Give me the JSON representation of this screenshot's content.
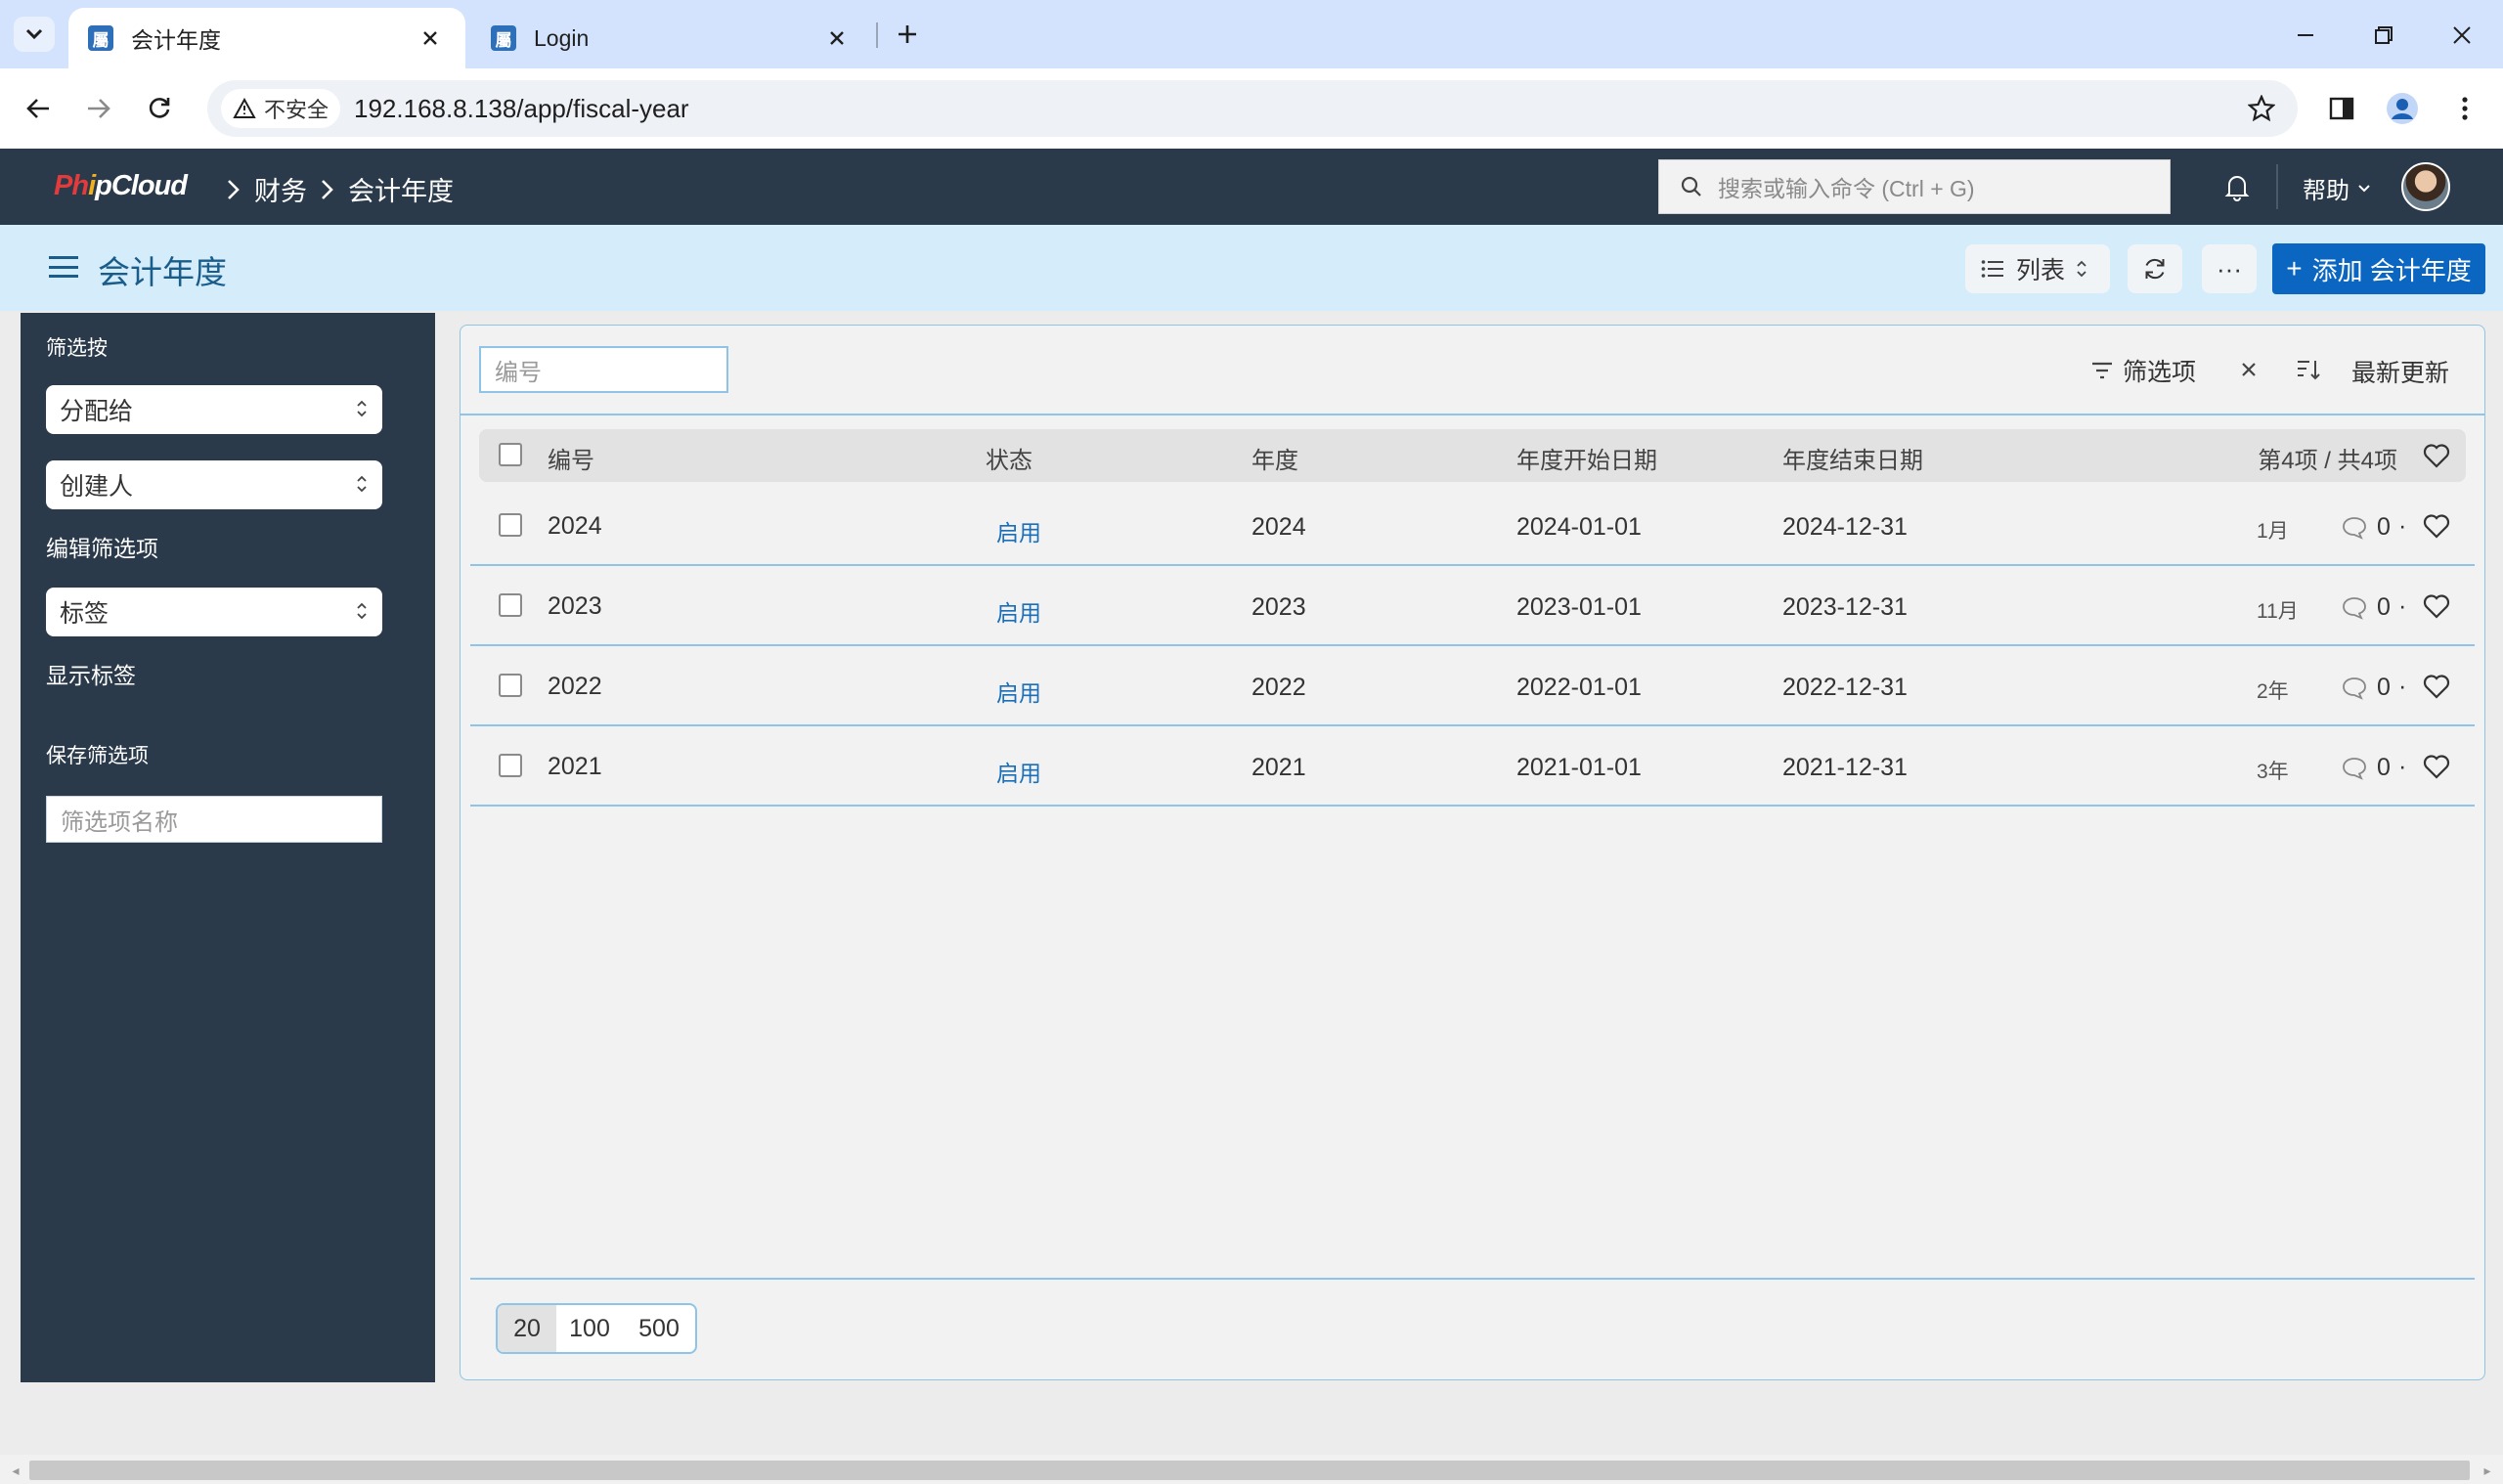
{
  "browser": {
    "tabs": [
      {
        "title": "会计年度",
        "favicon": "屬",
        "active": true
      },
      {
        "title": "Login",
        "favicon": "屬",
        "active": false
      }
    ],
    "security_label": "不安全",
    "url": "192.168.8.138/app/fiscal-year"
  },
  "navbar": {
    "logo_part1": "Ph",
    "logo_part2": "i",
    "logo_part3": "pCloud",
    "breadcrumbs": [
      "财务",
      "会计年度"
    ],
    "search_placeholder": "搜索或输入命令 (Ctrl + G)",
    "help_label": "帮助"
  },
  "pagehead": {
    "title": "会计年度",
    "view_label": "列表",
    "more_label": "···",
    "add_label": "添加 会计年度"
  },
  "sidebar": {
    "filter_by_label": "筛选按",
    "assigned_to": "分配给",
    "created_by": "创建人",
    "edit_filters": "编辑筛选项",
    "tags": "标签",
    "show_tags": "显示标签",
    "save_filter_label": "保存筛选项",
    "filter_name_placeholder": "筛选项名称"
  },
  "list": {
    "id_filter_placeholder": "编号",
    "filter_label": "筛选项",
    "sort_label": "最新更新",
    "columns": [
      "编号",
      "状态",
      "年度",
      "年度开始日期",
      "年度结束日期"
    ],
    "count_label": "第4项 / 共4项",
    "rows": [
      {
        "id": "2024",
        "status": "启用",
        "year": "2024",
        "start": "2024-01-01",
        "end": "2024-12-31",
        "ago": "1月",
        "comments": "0"
      },
      {
        "id": "2023",
        "status": "启用",
        "year": "2023",
        "start": "2023-01-01",
        "end": "2023-12-31",
        "ago": "11月",
        "comments": "0"
      },
      {
        "id": "2022",
        "status": "启用",
        "year": "2022",
        "start": "2022-01-01",
        "end": "2022-12-31",
        "ago": "2年",
        "comments": "0"
      },
      {
        "id": "2021",
        "status": "启用",
        "year": "2021",
        "start": "2021-01-01",
        "end": "2021-12-31",
        "ago": "3年",
        "comments": "0"
      }
    ],
    "page_sizes": [
      "20",
      "100",
      "500"
    ],
    "selected_page_size": "20"
  },
  "colors": {
    "navbar_bg": "#2b3a4a",
    "pagehead_bg": "#d5ecfb",
    "primary": "#0a66c0",
    "border_accent": "#8fc4e6"
  }
}
